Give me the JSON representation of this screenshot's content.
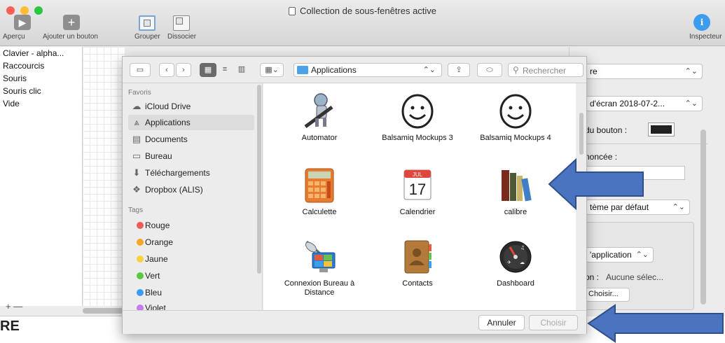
{
  "window": {
    "title": "Collection de sous-fenêtres active",
    "toolbar": {
      "apercu": "Aperçu",
      "ajouter": "Ajouter un bouton",
      "grouper": "Grouper",
      "dissocier": "Dissocier",
      "inspecteur": "Inspecteur"
    },
    "left_list": [
      "Clavier - alpha...",
      "Raccourcis",
      "Souris",
      "Souris clic",
      "Vide"
    ],
    "plus_minus": "+ —",
    "stray_text": "RE"
  },
  "inspector": {
    "popup1": "re",
    "popup2": "d'écran 2018-07-2...",
    "button_color_label": "du bouton :",
    "enonce_label": "noncée :",
    "popup3": "tème par défaut",
    "popup4": "'application",
    "selection_label": "on :",
    "selection_value": "Aucune sélec...",
    "choisir": "Choisir..."
  },
  "dialog": {
    "location": "Applications",
    "search_placeholder": "Rechercher",
    "sidebar": {
      "favoris_heading": "Favoris",
      "favoris": [
        {
          "label": "iCloud Drive",
          "icon": "cloud-icon"
        },
        {
          "label": "Applications",
          "icon": "applications-icon",
          "selected": true
        },
        {
          "label": "Documents",
          "icon": "documents-icon"
        },
        {
          "label": "Bureau",
          "icon": "desktop-icon"
        },
        {
          "label": "Téléchargements",
          "icon": "download-icon"
        },
        {
          "label": "Dropbox (ALIS)",
          "icon": "dropbox-icon"
        }
      ],
      "tags_heading": "Tags",
      "tags": [
        {
          "label": "Rouge",
          "color": "#f05a57"
        },
        {
          "label": "Orange",
          "color": "#f5a623"
        },
        {
          "label": "Jaune",
          "color": "#f8d23c"
        },
        {
          "label": "Vert",
          "color": "#5ac93f"
        },
        {
          "label": "Bleu",
          "color": "#3b9cf5"
        },
        {
          "label": "Violet",
          "color": "#c37de8"
        }
      ]
    },
    "files": [
      {
        "name": "Automator",
        "icon": "automator-icon"
      },
      {
        "name": "Balsamiq Mockups 3",
        "icon": "smiley-icon"
      },
      {
        "name": "Balsamiq Mockups 4",
        "icon": "smiley-icon"
      },
      {
        "name": "Calculette",
        "icon": "calculator-icon"
      },
      {
        "name": "Calendrier",
        "icon": "calendar-icon",
        "calendar_month": "JUL",
        "calendar_day": "17"
      },
      {
        "name": "calibre",
        "icon": "calibre-books-icon"
      },
      {
        "name": "Connexion Bureau à Distance",
        "icon": "remote-desktop-icon"
      },
      {
        "name": "Contacts",
        "icon": "contacts-icon"
      },
      {
        "name": "Dashboard",
        "icon": "dashboard-icon"
      }
    ],
    "cancel": "Annuler",
    "choose": "Choisir"
  },
  "colors": {
    "arrow": "#4a74bf",
    "arrow_border": "#2f4f8a",
    "selection": "#dcdcdc"
  }
}
